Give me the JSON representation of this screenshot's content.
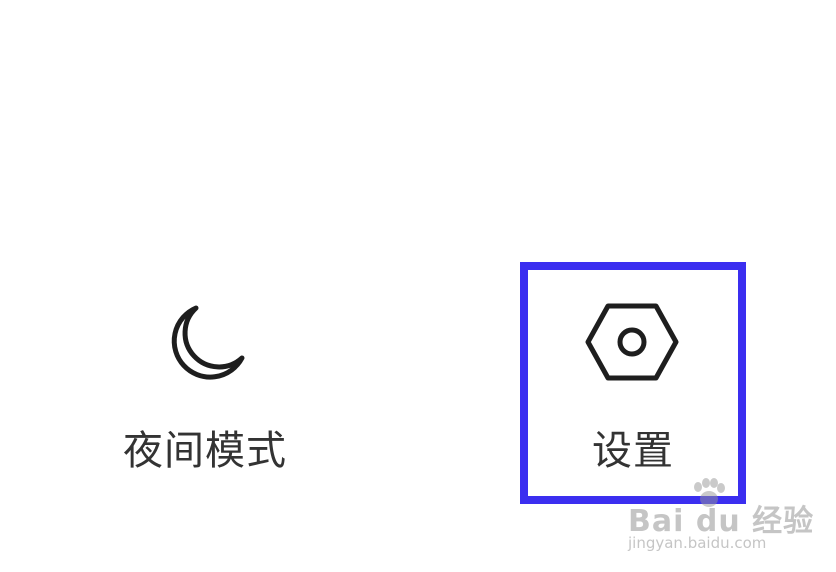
{
  "menu": {
    "night_mode": {
      "label": "夜间模式",
      "icon": "moon-icon"
    },
    "settings": {
      "label": "设置",
      "icon": "hexagon-nut-icon"
    }
  },
  "highlight": {
    "color": "#3b2ef0"
  },
  "watermark": {
    "brand": "Bai du 经验",
    "url": "jingyan.baidu.com"
  }
}
